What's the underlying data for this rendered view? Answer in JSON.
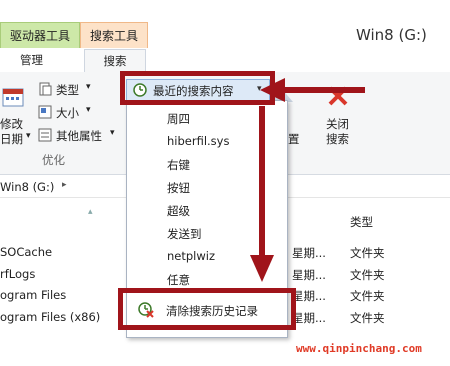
{
  "window": {
    "title": "Win8 (G:)",
    "context_tabs": {
      "drive_tools": "驱动器工具",
      "search_tools": "搜索工具"
    },
    "tabs": {
      "manage": "管理",
      "search": "搜索"
    }
  },
  "ribbon": {
    "type_label": "类型",
    "size_label": "大小",
    "other_props_label": "其他属性",
    "modify_label_1": "修改",
    "modify_label_2": "日期",
    "refine_group": "优化",
    "recent_searches_label": "最近的搜索内容",
    "close_label_1": "关闭",
    "close_label_2": "搜索",
    "location_fragment": "置"
  },
  "recent_searches_menu": {
    "items": [
      "周四",
      "hiberfil.sys",
      "右键",
      "按钮",
      "超级",
      "发送到",
      "netplwiz",
      "任意"
    ],
    "clear_label": "清除搜索历史记录"
  },
  "address_bar": {
    "path": "Win8 (G:)"
  },
  "file_list": {
    "type_header": "类型",
    "rows": [
      {
        "name": "SOCache",
        "date": "星期...",
        "type": "文件夹"
      },
      {
        "name": "rfLogs",
        "date": "星期...",
        "type": "文件夹"
      },
      {
        "name": "ogram Files",
        "date": "星期...",
        "type": "文件夹"
      },
      {
        "name": "ogram Files (x86)",
        "date": "星期...",
        "type": "文件夹"
      }
    ]
  },
  "watermark": "www.qinpinchang.com",
  "colors": {
    "highlight_red": "#a0141a",
    "drive_tools_tab": "#cde8a8",
    "search_tools_tab": "#fde2c8",
    "selected_button": "#dde9f7"
  }
}
